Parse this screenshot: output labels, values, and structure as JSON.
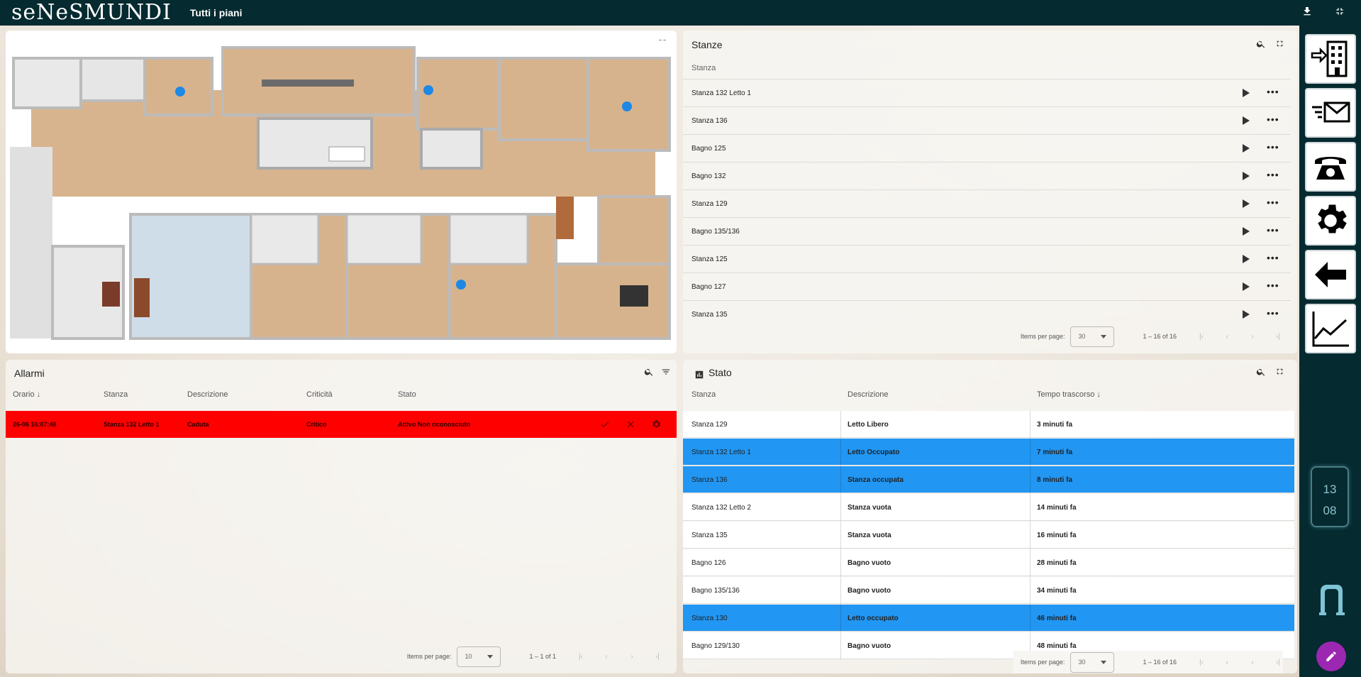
{
  "app": {
    "logo": "seNeSMUNDI",
    "page_title": "Tutti i piani"
  },
  "colors": {
    "topbar": "#052a30",
    "alarm": "#ff0000",
    "occupied": "#2196f3",
    "fab": "#9c27b0"
  },
  "stanze": {
    "title": "Stanze",
    "column": "Stanza",
    "rows": [
      "Stanza 132 Letto 1",
      "Stanza 136",
      "Bagno 125",
      "Bagno 132",
      "Stanza 129",
      "Bagno 135/136",
      "Stanza 125",
      "Bagno 127",
      "Stanza 135"
    ],
    "paginator": {
      "label": "Items per page:",
      "size": "30",
      "range": "1 – 16 of 16"
    }
  },
  "allarmi": {
    "title": "Allarmi",
    "columns": [
      "Orario",
      "Stanza",
      "Descrizione",
      "Criticità",
      "Stato"
    ],
    "rows": [
      {
        "orario": "26-06 16:07:48",
        "stanza": "Stanza 132 Letto 1",
        "descrizione": "Caduta",
        "criticita": "Critico",
        "stato": "Attivo Non riconosciuto"
      }
    ],
    "paginator": {
      "label": "Items per page:",
      "size": "10",
      "range": "1 – 1 of 1"
    }
  },
  "stato": {
    "title": "Stato",
    "columns": [
      "Stanza",
      "Descrizione",
      "Tempo trascorso"
    ],
    "rows": [
      {
        "stanza": "Stanza 129",
        "descrizione": "Letto Libero",
        "tempo": "3 minuti fa",
        "occupied": false
      },
      {
        "stanza": "Stanza 132 Letto 1",
        "descrizione": "Letto Occupato",
        "tempo": "7 minuti fa",
        "occupied": true
      },
      {
        "stanza": "Stanza 136",
        "descrizione": "Stanza occupata",
        "tempo": "8 minuti fa",
        "occupied": true
      },
      {
        "stanza": "Stanza 132 Letto 2",
        "descrizione": "Stanza vuota",
        "tempo": "14 minuti fa",
        "occupied": false
      },
      {
        "stanza": "Stanza 135",
        "descrizione": "Stanza vuota",
        "tempo": "16 minuti fa",
        "occupied": false
      },
      {
        "stanza": "Bagno 126",
        "descrizione": "Bagno vuoto",
        "tempo": "28 minuti fa",
        "occupied": false
      },
      {
        "stanza": "Bagno 135/136",
        "descrizione": "Bagno vuoto",
        "tempo": "34 minuti fa",
        "occupied": false
      },
      {
        "stanza": "Stanza 130",
        "descrizione": "Letto occupato",
        "tempo": "46 minuti fa",
        "occupied": true
      },
      {
        "stanza": "Bagno 129/130",
        "descrizione": "Bagno vuoto",
        "tempo": "48 minuti fa",
        "occupied": false
      }
    ],
    "paginator": {
      "label": "Items per page:",
      "size": "30",
      "range": "1 – 16 of 16"
    }
  },
  "clock": {
    "hours": "13",
    "minutes": "08"
  },
  "dock_icons": [
    "building-enter-icon",
    "mail-icon",
    "phone-icon",
    "gear-icon",
    "back-arrow-icon",
    "chart-icon"
  ]
}
